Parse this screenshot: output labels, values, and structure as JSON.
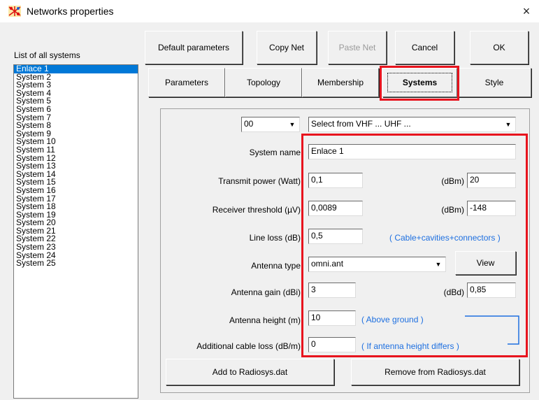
{
  "window": {
    "title": "Networks properties",
    "close_glyph": "×"
  },
  "list": {
    "label": "List of all systems",
    "items": [
      "Enlace 1",
      "System  2",
      "System  3",
      "System  4",
      "System  5",
      "System  6",
      "System  7",
      "System  8",
      "System  9",
      "System 10",
      "System 11",
      "System 12",
      "System 13",
      "System 14",
      "System 15",
      "System 16",
      "System 17",
      "System 18",
      "System 19",
      "System 20",
      "System 21",
      "System 22",
      "System 23",
      "System 24",
      "System 25"
    ],
    "selected_index": 0
  },
  "toolbar": {
    "default_params": "Default parameters",
    "copy_net": "Copy Net",
    "paste_net": "Paste Net",
    "cancel": "Cancel",
    "ok": "OK"
  },
  "tabs": {
    "parameters": "Parameters",
    "topology": "Topology",
    "membership": "Membership",
    "systems": "Systems",
    "style": "Style",
    "active": "systems"
  },
  "systems": {
    "index_select": "00",
    "band_select": "Select from VHF ... UHF ...",
    "system_name_label": "System name",
    "system_name": "Enlace 1",
    "transmit_power_label": "Transmit power (Watt)",
    "transmit_power": "0,1",
    "transmit_power_dbm_label": "(dBm)",
    "transmit_power_dbm": "20",
    "receiver_threshold_label": "Receiver threshold (µV)",
    "receiver_threshold": "0,0089",
    "receiver_threshold_dbm_label": "(dBm)",
    "receiver_threshold_dbm": "-148",
    "line_loss_label": "Line loss (dB)",
    "line_loss": "0,5",
    "line_loss_note": "( Cable+cavities+connectors )",
    "antenna_type_label": "Antenna type",
    "antenna_type": "omni.ant",
    "view_button": "View",
    "antenna_gain_label": "Antenna gain (dBi)",
    "antenna_gain": "3",
    "antenna_gain_dbd_label": "(dBd)",
    "antenna_gain_dbd": "0,85",
    "antenna_height_label": "Antenna height (m)",
    "antenna_height": "10",
    "antenna_height_note": "( Above ground )",
    "cable_loss_label": "Additional cable loss (dB/m)",
    "cable_loss": "0",
    "cable_loss_note": "( If antenna height differs )",
    "add_button": "Add to Radiosys.dat",
    "remove_button": "Remove from Radiosys.dat"
  },
  "colors": {
    "highlight": "#e8141e",
    "selection": "#0078d7",
    "note_blue": "#1d6fe0"
  }
}
